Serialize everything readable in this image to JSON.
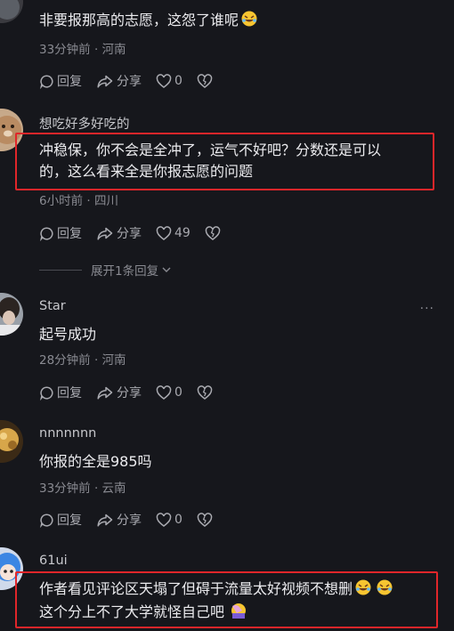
{
  "comments": [
    {
      "username": "",
      "text": "非要报那高的志愿，这怨了谁呢",
      "text_emoji": [
        "grinning-tears-emoji"
      ],
      "meta": "33分钟前 · 河南",
      "reply_label": "回复",
      "share_label": "分享",
      "like_count": "0"
    },
    {
      "username": "想吃好多好吃的",
      "text_line1": "冲稳保，你不会是全冲了，运气不好吧？分数还是可以",
      "text_line2": "的，这么看来全是你报志愿的问题",
      "meta": "6小时前 · 四川",
      "reply_label": "回复",
      "share_label": "分享",
      "like_count": "49",
      "expand_label": "展开1条回复"
    },
    {
      "username": "Star",
      "text": "起号成功",
      "meta": "28分钟前 · 河南",
      "reply_label": "回复",
      "share_label": "分享",
      "like_count": "0",
      "more_label": "···"
    },
    {
      "username": "nnnnnnn",
      "text": "你报的全是985吗",
      "meta": "33分钟前 · 云南",
      "reply_label": "回复",
      "share_label": "分享",
      "like_count": "0"
    },
    {
      "username": "61ui",
      "text_line1": "作者看见评论区天塌了但碍于流量太好视频不想删",
      "text_line2": "这个分上不了大学就怪自己吧",
      "meta": "",
      "text_emoji": [
        "grinning-tears-emoji",
        "grinning-tears-emoji",
        "facepalm-emoji"
      ]
    }
  ],
  "colors": {
    "background": "#16171c",
    "highlight_box": "#e0262a",
    "meta_text": "#8a8b92"
  }
}
